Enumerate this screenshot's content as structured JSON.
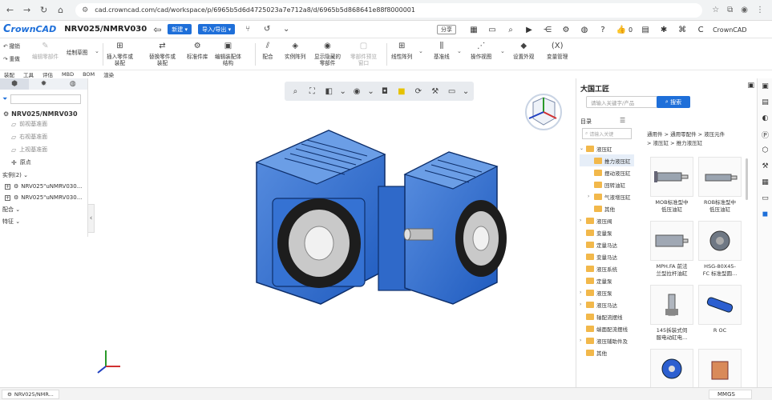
{
  "browser": {
    "url": "cad.crowncad.com/cad/workspace/p/6965b5d6d4725023a7e712a8/d/6965b5d868641e88f8000001"
  },
  "header": {
    "logo_text": "rownCAD",
    "logo_initial": "C",
    "doc_title": "NRV025/NMRV030",
    "new_label": "新建",
    "import_label": "导入/导出",
    "share_label": "分享",
    "like_count": "0",
    "brand_right": "CrownCAD"
  },
  "ribbon": {
    "undo": "撤销",
    "redo": "重做",
    "edit_part": "编辑零部件",
    "sketch": "绘制草图",
    "insert_part_l1": "插入零件或",
    "insert_part_l2": "装配",
    "replace_part_l1": "替换零件或",
    "replace_part_l2": "装配",
    "std_lib": "标准件库",
    "edit_assembly_l1": "编辑装配体",
    "edit_assembly_l2": "结构",
    "mate": "配合",
    "instance": "实例阵列",
    "show_hidden_l1": "显示隐藏的",
    "show_hidden_l2": "零部件",
    "preview_l1": "零部件预览",
    "preview_l2": "窗口",
    "linear": "线性阵列",
    "baseline": "基准线",
    "op_view": "操作视图",
    "appearance": "设置外观",
    "var_icon": "(X)",
    "var_manage": "变量管理"
  },
  "ribbon_tabs": [
    "装配",
    "工具",
    "评估",
    "MBD",
    "BOM",
    "渲染"
  ],
  "left_panel": {
    "root": "NRV025/NMRV030",
    "planes": [
      "前视基准面",
      "右视基准面",
      "上视基准面"
    ],
    "origin": "原点",
    "instances_label": "实例(2)",
    "instances": [
      "NRV025\"uNMRV030...",
      "NRV025\"uNMRV030..."
    ],
    "mates_label": "配合",
    "features_label": "特征"
  },
  "right_panel": {
    "title": "大国工匠",
    "search_placeholder": "请输入关键字/产品",
    "search_button": "搜索",
    "catalog_label": "目录",
    "catalog_search_placeholder": "请输入关键",
    "tree": [
      {
        "label": "液压缸",
        "arrow": "down",
        "indent": 0
      },
      {
        "label": "推力液压缸",
        "arrow": "",
        "indent": 1,
        "selected": true
      },
      {
        "label": "摆动液压缸",
        "arrow": "",
        "indent": 1
      },
      {
        "label": "回转油缸",
        "arrow": "",
        "indent": 1
      },
      {
        "label": "气液增压缸",
        "arrow": "right",
        "indent": 1
      },
      {
        "label": "其他",
        "arrow": "",
        "indent": 1
      },
      {
        "label": "液压阀",
        "arrow": "right",
        "indent": 0
      },
      {
        "label": "变量泵",
        "arrow": "",
        "indent": 0
      },
      {
        "label": "定量马达",
        "arrow": "",
        "indent": 0
      },
      {
        "label": "变量马达",
        "arrow": "",
        "indent": 0
      },
      {
        "label": "液压系统",
        "arrow": "",
        "indent": 0
      },
      {
        "label": "定量泵",
        "arrow": "",
        "indent": 0
      },
      {
        "label": "液压泵",
        "arrow": "right",
        "indent": 0
      },
      {
        "label": "液压马达",
        "arrow": "right",
        "indent": 0
      },
      {
        "label": "轴配流摆线",
        "arrow": "",
        "indent": 0
      },
      {
        "label": "端面配流摆线",
        "arrow": "",
        "indent": 0
      },
      {
        "label": "液压辅助件及",
        "arrow": "right",
        "indent": 0
      },
      {
        "label": "其他",
        "arrow": "",
        "indent": 0
      }
    ],
    "breadcrumb_line1": "通用件 > 通用零配件 > 液压元件",
    "breadcrumb_line2": "> 液压缸 > 推力液压缸",
    "cards": [
      {
        "l1": "MOB标准型中",
        "l2": "低压油缸",
        "brand": "EAKS"
      },
      {
        "l1": "ROB标准型中",
        "l2": "低压油缸",
        "brand": "EAKS"
      },
      {
        "l1": "MPH.FA 前法",
        "l2": "兰型拉杆油缸",
        "brand": "EAKS"
      },
      {
        "l1": "HSG-80X45-",
        "l2": "FC 标准型圆...",
        "brand": ""
      },
      {
        "l1": "145拆装式伺",
        "l2": "服电动缸电...",
        "brand": ""
      },
      {
        "l1": "R OC",
        "l2": "",
        "brand": ""
      },
      {
        "l1": "",
        "l2": "",
        "brand": ""
      },
      {
        "l1": "",
        "l2": "",
        "brand": ""
      }
    ]
  },
  "bottom": {
    "doc_tab": "NRV025/NMR...",
    "unit": "MMGS"
  }
}
